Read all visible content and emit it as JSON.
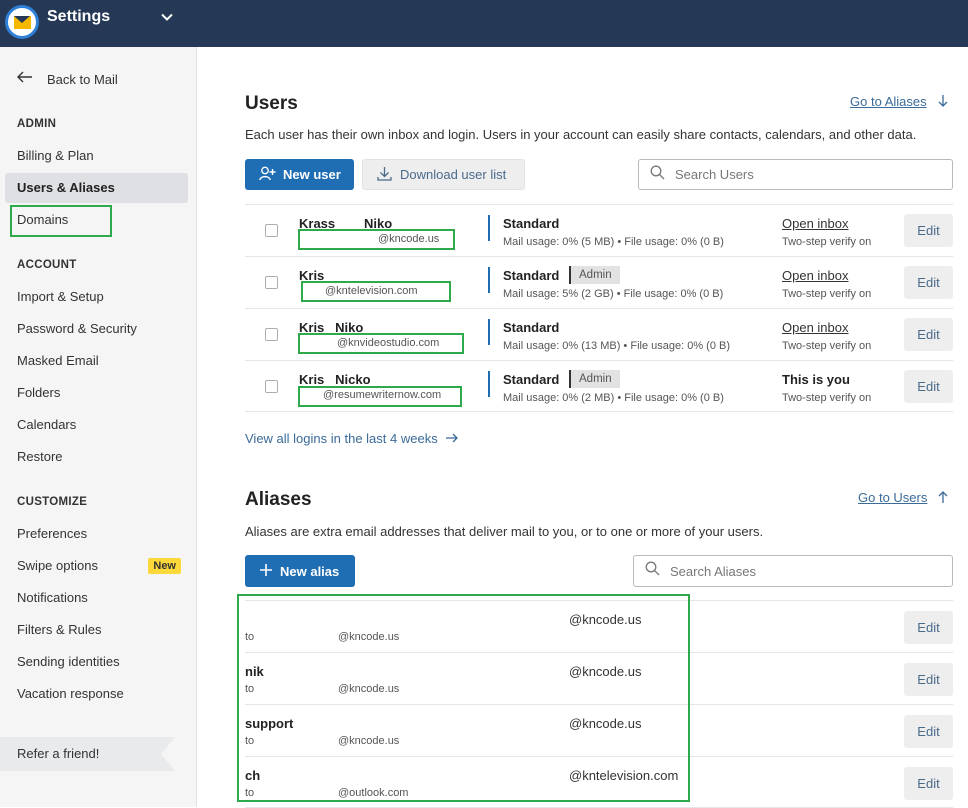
{
  "app": {
    "title": "Settings"
  },
  "sidebar": {
    "back": "Back to Mail",
    "admin_head": "ADMIN",
    "admin_items": [
      "Billing & Plan",
      "Users & Aliases",
      "Domains"
    ],
    "account_head": "ACCOUNT",
    "account_items": [
      "Import & Setup",
      "Password & Security",
      "Masked Email",
      "Folders",
      "Calendars",
      "Restore"
    ],
    "customize_head": "CUSTOMIZE",
    "customize_items": [
      "Preferences",
      "Swipe options",
      "Notifications",
      "Filters & Rules",
      "Sending identities",
      "Vacation response"
    ],
    "new_badge": "New",
    "refer": "Refer a friend!"
  },
  "users": {
    "title": "Users",
    "goto": "Go to Aliases",
    "description": "Each user has their own inbox and login. Users in your account can easily share contacts, calendars, and other data.",
    "new_user": "New user",
    "download": "Download user list",
    "search_placeholder": "Search Users",
    "rows": [
      {
        "name": "Krass        Niko",
        "email": "@kncode.us",
        "plan": "Standard",
        "badge": "",
        "usage": "Mail usage: 0% (5 MB) • File usage: 0% (0 B)",
        "action": "Open inbox",
        "twostep": "Two-step verify on",
        "edit": "Edit"
      },
      {
        "name": "Kris",
        "email": "@kntelevision.com",
        "plan": "Standard",
        "badge": "Admin",
        "usage": "Mail usage: 5% (2 GB) • File usage: 0% (0 B)",
        "action": "Open inbox",
        "twostep": "Two-step verify on",
        "edit": "Edit"
      },
      {
        "name": "Kris   Niko",
        "email": "@knvideostudio.com",
        "plan": "Standard",
        "badge": "",
        "usage": "Mail usage: 0% (13 MB) • File usage: 0% (0 B)",
        "action": "Open inbox",
        "twostep": "Two-step verify on",
        "edit": "Edit"
      },
      {
        "name": "Kris   Nicko",
        "email": "@resumewriternow.com",
        "plan": "Standard",
        "badge": "Admin",
        "usage": "Mail usage: 0% (2 MB) • File usage: 0% (0 B)",
        "action": "This is you",
        "twostep": "Two-step verify on",
        "edit": "Edit"
      }
    ],
    "view_logins": "View all logins in the last 4 weeks"
  },
  "aliases": {
    "title": "Aliases",
    "goto": "Go to Users",
    "description": "Aliases are extra email addresses that deliver mail to you, or to one or more of your users.",
    "new_alias": "New alias",
    "search_placeholder": "Search Aliases",
    "rows": [
      {
        "name": "",
        "domain": "@kncode.us",
        "to": "to",
        "target": "@kncode.us",
        "edit": "Edit"
      },
      {
        "name": "nik",
        "domain": "@kncode.us",
        "to": "to",
        "target": "@kncode.us",
        "edit": "Edit"
      },
      {
        "name": "support",
        "domain": "@kncode.us",
        "to": "to",
        "target": "@kncode.us",
        "edit": "Edit"
      },
      {
        "name": "ch",
        "domain": "@kntelevision.com",
        "to": "to",
        "target": "@outlook.com",
        "edit": "Edit"
      }
    ]
  },
  "colors": {
    "topbar": "#253957",
    "primary": "#1f6db2",
    "annotation": "#2ea94b",
    "new_badge": "#fdd83b"
  }
}
